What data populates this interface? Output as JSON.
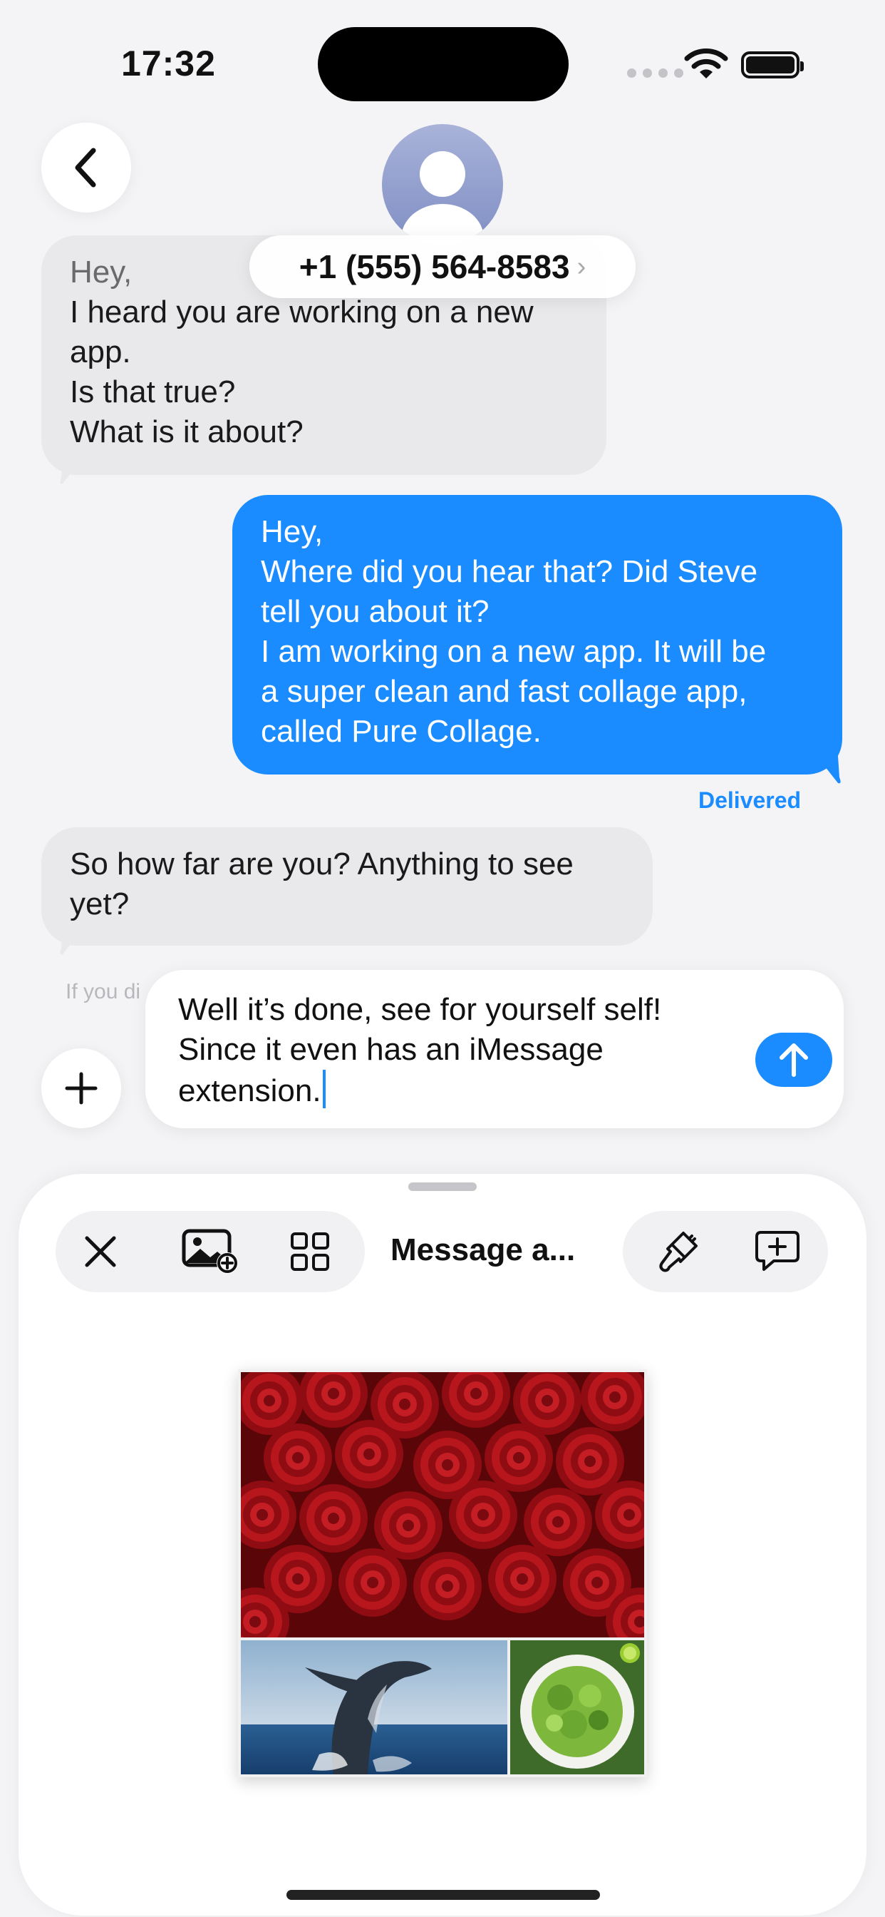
{
  "status_bar": {
    "time": "17:32"
  },
  "header": {
    "contact": "+1 (555) 564-8583",
    "chevron": "›"
  },
  "messages": [
    {
      "direction": "incoming",
      "lines": [
        "Hey,",
        "I heard you are working on a new",
        "app.",
        "Is that true?",
        "What is it about?"
      ]
    },
    {
      "direction": "outgoing",
      "lines": [
        "Hey,",
        "Where did you hear that? Did Steve",
        "tell you about it?",
        "I am working on a new app. It will be",
        "a super clean and fast collage app,",
        "called Pure Collage."
      ]
    },
    {
      "direction": "incoming",
      "lines": [
        "So how far are you? Anything to see",
        "yet?"
      ]
    }
  ],
  "delivered_label": "Delivered",
  "hint_text": "If you di",
  "compose": {
    "lines": [
      "Well it’s done, see for yourself self!",
      "Since it even has an iMessage",
      "extension."
    ]
  },
  "sheet": {
    "title": "Message a..."
  },
  "colors": {
    "accent": "#1a8cff",
    "incoming_bubble": "#e9e9eb"
  }
}
